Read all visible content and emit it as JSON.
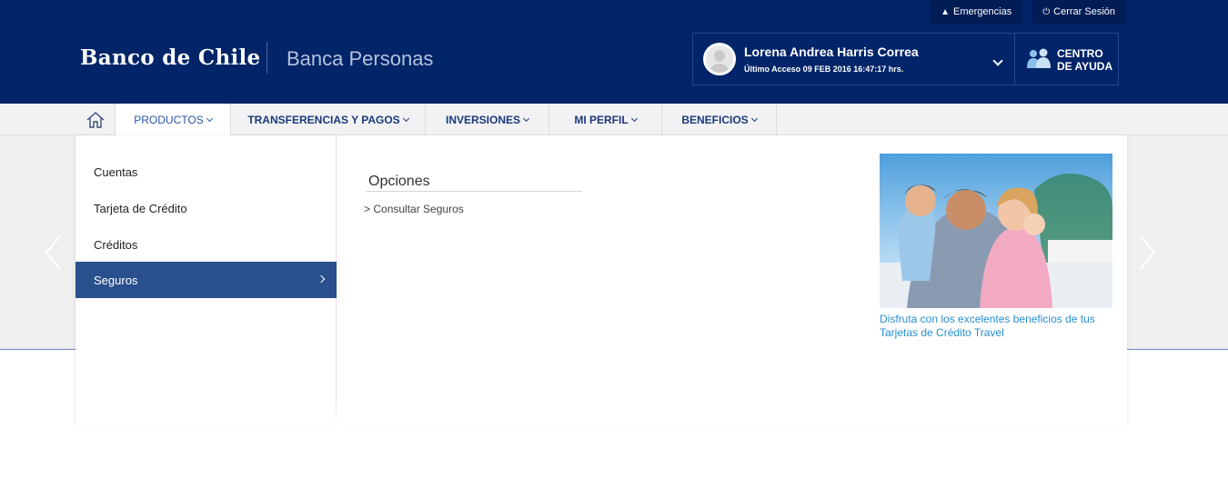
{
  "top_links": [
    {
      "icon": "warning-icon",
      "label": "Emergencias"
    },
    {
      "icon": "power-icon",
      "label": "Cerrar Sesión"
    }
  ],
  "brand": {
    "logo": "Banco de Chile",
    "section": "Banca Personas"
  },
  "user": {
    "name": "Lorena Andrea Harris Correa",
    "last_access": "Último Acceso 09 FEB 2016 16:47:17 hrs."
  },
  "help": {
    "line1": "CENTRO",
    "line2": "DE AYUDA"
  },
  "nav": {
    "items": [
      {
        "label": "PRODUCTOS"
      },
      {
        "label": "TRANSFERENCIAS Y PAGOS"
      },
      {
        "label": "INVERSIONES"
      },
      {
        "label": "MI PERFIL"
      },
      {
        "label": "BENEFICIOS"
      }
    ]
  },
  "menu": {
    "items": [
      {
        "label": "Cuentas"
      },
      {
        "label": "Tarjeta de Crédito"
      },
      {
        "label": "Créditos"
      },
      {
        "label": "Seguros"
      }
    ],
    "selected": "Seguros"
  },
  "options": {
    "title": "Opciones",
    "links": [
      {
        "label": "Consultar Seguros",
        "prefix": ">"
      }
    ]
  },
  "promo": {
    "text": "Disfruta con los excelentes beneficios de tus Tarjetas de Crédito Travel"
  },
  "colors": {
    "header": "#022468",
    "accent": "#294f8c",
    "link": "#2a8fd1"
  }
}
